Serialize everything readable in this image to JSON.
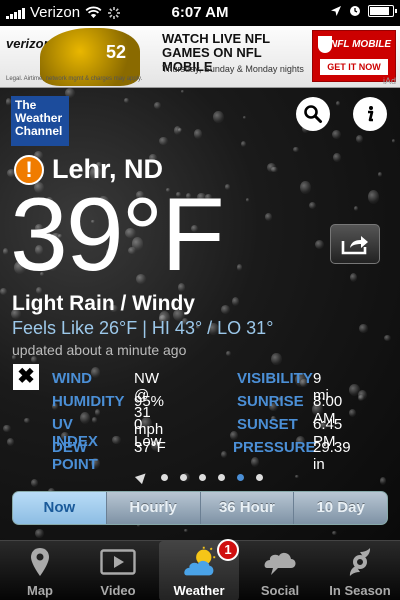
{
  "status_bar": {
    "carrier": "Verizon",
    "time": "6:07 AM",
    "battery_level": 0.85
  },
  "ad": {
    "carrier_logo": "verizon",
    "jersey_number": "52",
    "headline": "WATCH LIVE NFL GAMES ON NFL MOBILE",
    "schedule": "Thursday, Sunday & Monday nights",
    "legal": "Legal. Airtime, network mgmt & charges may apply.",
    "brand": "NFL MOBILE",
    "cta": "GET IT NOW",
    "network_label": "iAd"
  },
  "header": {
    "logo_text": "The Weather Channel",
    "search_icon": "search-icon",
    "info_icon": "info-icon"
  },
  "weather": {
    "alert_symbol": "!",
    "location": "Lehr, ND",
    "temperature": "39°F",
    "condition": "Light Rain / Windy",
    "feels_like": "Feels Like 26°F | HI 43° / LO 31°",
    "updated": "updated about a minute ago",
    "close_symbol": "✖"
  },
  "details": {
    "wind_label": "WIND",
    "wind_value": "NW @ 31 mph",
    "visibility_label": "VISIBILITY",
    "visibility_value": "9 mi",
    "humidity_label": "HUMIDITY",
    "humidity_value": "95%",
    "sunrise_label": "SUNRISE",
    "sunrise_value": "8:00 AM",
    "uv_label": "UV INDEX",
    "uv_value": "0 Low",
    "sunset_label": "SUNSET",
    "sunset_value": "6:45 PM",
    "dewpoint_label": "DEW POINT",
    "dewpoint_value": "37°F",
    "pressure_label": "PRESSURE",
    "pressure_value": "29.39 in"
  },
  "pager": {
    "count": 7,
    "active_index": 5
  },
  "forecast_tabs": {
    "now": "Now",
    "hourly": "Hourly",
    "thirtysix": "36 Hour",
    "tenday": "10 Day",
    "active": "Now"
  },
  "tab_bar": {
    "map": "Map",
    "video": "Video",
    "weather": "Weather",
    "weather_badge": "1",
    "social": "Social",
    "season": "In Season",
    "active": "Weather"
  },
  "colors": {
    "accent_blue": "#4b8fd6",
    "alert_orange": "#f07c00",
    "logo_blue": "#1c4c9c",
    "badge_red": "#d01010"
  }
}
